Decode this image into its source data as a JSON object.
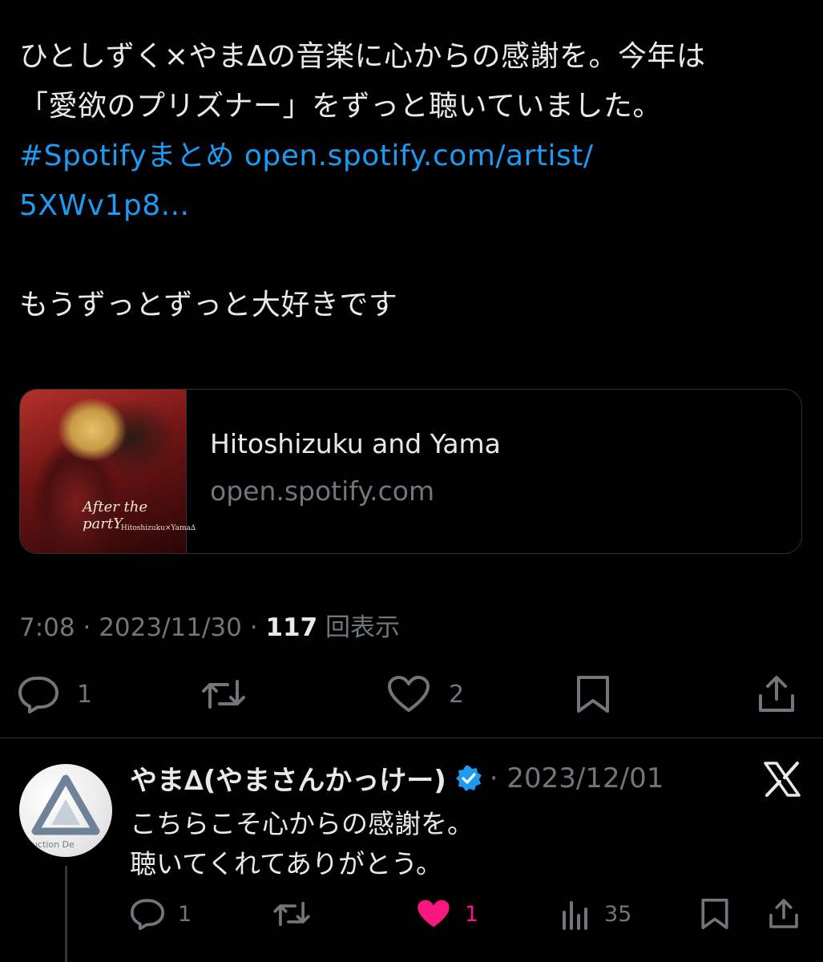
{
  "tweet": {
    "lines": [
      "ひとしずく×やま∆の音楽に心からの感謝を。今年は",
      "「愛欲のプリズナー」をずっと聴いていました。"
    ],
    "hashtag": "#Spotifyまとめ",
    "url_part1": "open.spotify.com/artist/",
    "url_part2": "5XWv1p8...",
    "closing": "もうずっとずっと大好きです"
  },
  "card": {
    "title": "Hitoshizuku and Yama",
    "domain": "open.spotify.com",
    "thumb_title": "After the partY",
    "thumb_sub": "Hitoshizuku×Yama∆"
  },
  "meta": {
    "time": "7:08",
    "sep1": " · ",
    "date": "2023/11/30",
    "sep2": " · ",
    "views": "117",
    "views_label": "回表示"
  },
  "actions": {
    "replies": "1",
    "likes": "2"
  },
  "reply": {
    "name": "やま∆(やまさんかっけー)",
    "date": "· 2023/12/01",
    "avatar_text": "nduction De",
    "lines": [
      "こちらこそ心からの感謝を。",
      "聴いてくれてありがとう。"
    ],
    "replies": "1",
    "likes": "1",
    "views": "35"
  },
  "colors": {
    "background": "#000000",
    "link": "#1d9bf0",
    "muted": "#71767b",
    "like": "#f91880",
    "verified": "#1d9bf0"
  },
  "icons": [
    "reply-icon",
    "retweet-icon",
    "like-icon",
    "bookmark-icon",
    "share-icon",
    "views-icon",
    "verified-badge-icon",
    "x-logo-icon"
  ]
}
